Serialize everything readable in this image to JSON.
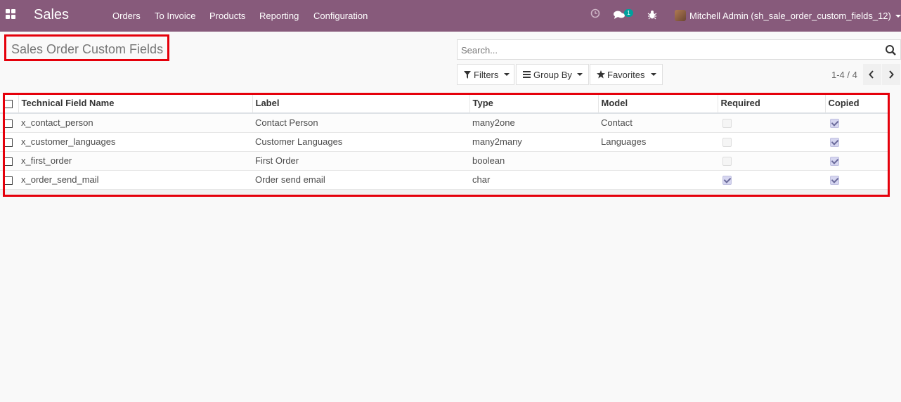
{
  "navbar": {
    "brand": "Sales",
    "menu": [
      "Orders",
      "To Invoice",
      "Products",
      "Reporting",
      "Configuration"
    ],
    "chat_badge": "1",
    "user": "Mitchell Admin (sh_sale_order_custom_fields_12)",
    "icons": [
      "apps-icon",
      "clock-icon",
      "chat-icon",
      "bug-icon",
      "avatar"
    ]
  },
  "control_panel": {
    "title": "Sales Order Custom Fields",
    "search_placeholder": "Search...",
    "filters_label": "Filters",
    "groupby_label": "Group By",
    "favorites_label": "Favorites",
    "pager": "1-4 / 4"
  },
  "table": {
    "columns": [
      "Technical Field Name",
      "Label",
      "Type",
      "Model",
      "Required",
      "Copied"
    ],
    "rows": [
      {
        "name": "x_contact_person",
        "label": "Contact Person",
        "type": "many2one",
        "model": "Contact",
        "required": false,
        "copied": true
      },
      {
        "name": "x_customer_languages",
        "label": "Customer Languages",
        "type": "many2many",
        "model": "Languages",
        "required": false,
        "copied": true
      },
      {
        "name": "x_first_order",
        "label": "First Order",
        "type": "boolean",
        "model": "",
        "required": false,
        "copied": true
      },
      {
        "name": "x_order_send_mail",
        "label": "Order send email",
        "type": "char",
        "model": "",
        "required": true,
        "copied": true
      }
    ]
  },
  "colors": {
    "navbar": "#875a7b",
    "highlight": "#e5000b",
    "badge": "#00a09d"
  }
}
